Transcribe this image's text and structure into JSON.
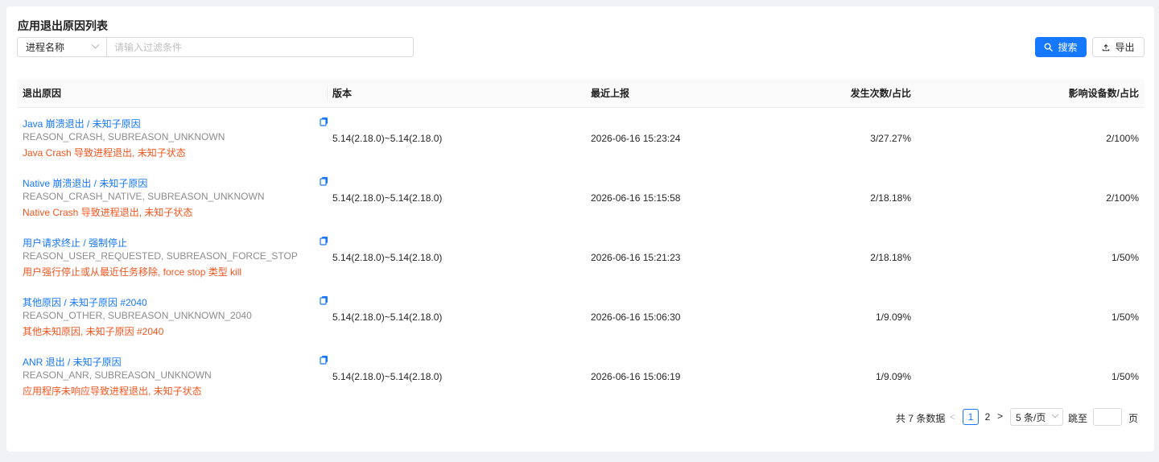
{
  "page_title": "应用退出原因列表",
  "filter": {
    "field_label": "进程名称",
    "placeholder": "请输入过滤条件",
    "value": ""
  },
  "buttons": {
    "search": "搜索",
    "export": "导出"
  },
  "colors": {
    "primary": "#1677ff",
    "description": "#f5541e",
    "code": "#8c8c8c"
  },
  "table": {
    "columns": [
      "退出原因",
      "版本",
      "最近上报",
      "发生次数/占比",
      "影响设备数/占比"
    ],
    "rows": [
      {
        "title": "Java 崩溃退出 / 未知子原因",
        "code": "REASON_CRASH, SUBREASON_UNKNOWN",
        "desc": "Java Crash 导致进程退出, 未知子状态",
        "version": "5.14(2.18.0)~5.14(2.18.0)",
        "last_report": "2026-06-16 15:23:24",
        "count_ratio": "3/27.27%",
        "devices_ratio": "2/100%"
      },
      {
        "title": "Native 崩溃退出 / 未知子原因",
        "code": "REASON_CRASH_NATIVE, SUBREASON_UNKNOWN",
        "desc": "Native Crash 导致进程退出, 未知子状态",
        "version": "5.14(2.18.0)~5.14(2.18.0)",
        "last_report": "2026-06-16 15:15:58",
        "count_ratio": "2/18.18%",
        "devices_ratio": "2/100%"
      },
      {
        "title": "用户请求终止 / 强制停止",
        "code": "REASON_USER_REQUESTED, SUBREASON_FORCE_STOP",
        "desc": "用户强行停止或从最近任务移除, force stop 类型 kill",
        "version": "5.14(2.18.0)~5.14(2.18.0)",
        "last_report": "2026-06-16 15:21:23",
        "count_ratio": "2/18.18%",
        "devices_ratio": "1/50%"
      },
      {
        "title": "其他原因 / 未知子原因 #2040",
        "code": "REASON_OTHER, SUBREASON_UNKNOWN_2040",
        "desc": "其他未知原因, 未知子原因 #2040",
        "version": "5.14(2.18.0)~5.14(2.18.0)",
        "last_report": "2026-06-16 15:06:30",
        "count_ratio": "1/9.09%",
        "devices_ratio": "1/50%"
      },
      {
        "title": "ANR 退出 / 未知子原因",
        "code": "REASON_ANR, SUBREASON_UNKNOWN",
        "desc": "应用程序未响应导致进程退出, 未知子状态",
        "version": "5.14(2.18.0)~5.14(2.18.0)",
        "last_report": "2026-06-16 15:06:19",
        "count_ratio": "1/9.09%",
        "devices_ratio": "1/50%"
      }
    ]
  },
  "pagination": {
    "total_text": "共 7 条数据",
    "prev": "<",
    "pages": [
      "1",
      "2"
    ],
    "current": "1",
    "next": ">",
    "page_size": "5 条/页",
    "jump_label": "跳至",
    "page_suffix": "页"
  }
}
